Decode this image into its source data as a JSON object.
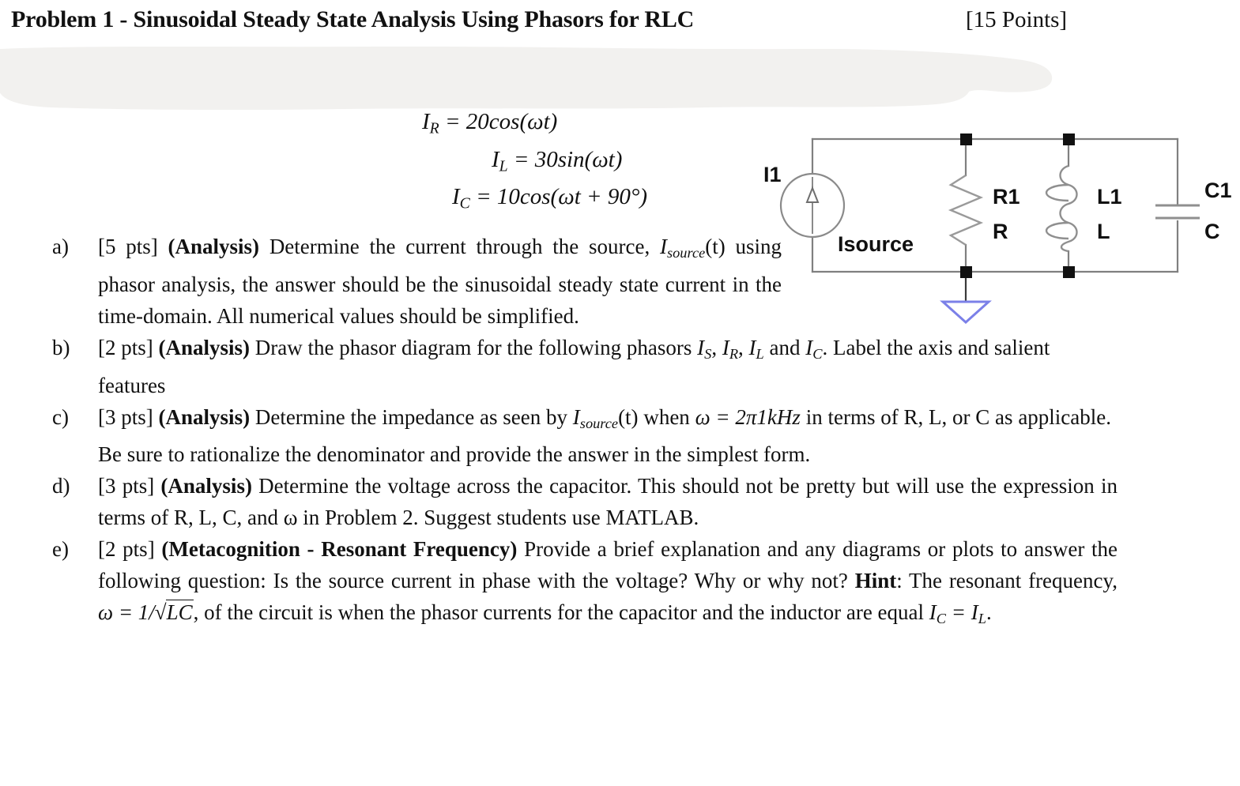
{
  "header": {
    "title": "Problem 1 - Sinusoidal Steady State Analysis Using Phasors for RLC",
    "points": "[15 Points]"
  },
  "redaction": {
    "color": "#f2f1ef",
    "note": "light gray whiteout smear covering a line of text"
  },
  "equations": {
    "line1_lhs": "I",
    "line1_sub": "R",
    "line1_rhs": "= 20cos(ωt)",
    "line2_lhs": "I",
    "line2_sub": "L",
    "line2_rhs": "= 30sin(ωt)",
    "line3_lhs": "I",
    "line3_sub": "C",
    "line3_rhs": "= 10cos(ωt + 90°)"
  },
  "circuit": {
    "source_designator": "I1",
    "source_name": "Isource",
    "resistor_designator": "R1",
    "resistor_value": "R",
    "inductor_designator": "L1",
    "inductor_value": "L",
    "capacitor_designator": "C1",
    "capacitor_value": "C",
    "ground_color": "#7b80e8",
    "wire_color": "#808080",
    "node_color": "#111111"
  },
  "items": [
    {
      "marker": "a)",
      "pts": "[5 pts]",
      "tag": "(Analysis)",
      "text_1": "Determine the current through the source, ",
      "sym": "I",
      "sym_sub": "source",
      "text_2": "(t) using phasor analysis, the answer should be the sinusoidal steady state current in the time-domain. All numerical values should be simplified."
    },
    {
      "marker": "b)",
      "pts": "[2 pts]",
      "tag": "(Analysis)",
      "text_1": "Draw the phasor diagram for the following phasors ",
      "sym_s": "I",
      "sym_s_sub": "S",
      "sep_1": ", ",
      "sym_r": "I",
      "sym_r_sub": "R",
      "sep_2": ", ",
      "sym_l": "I",
      "sym_l_sub": "L",
      "sep_3": " and ",
      "sym_c": "I",
      "sym_c_sub": "C",
      "text_2": ". Label the axis and salient features"
    },
    {
      "marker": "c)",
      "pts": "[3 pts]",
      "tag": "(Analysis)",
      "text_1": "Determine the impedance as seen by ",
      "sym": "I",
      "sym_sub": "source",
      "text_2": "(t) when ",
      "formula": "ω = 2π1kHz",
      "text_3": " in terms of R, L, or C as applicable. Be sure to rationalize the denominator and provide the answer in the simplest form."
    },
    {
      "marker": "d)",
      "pts": "[3 pts]",
      "tag": "(Analysis)",
      "text_1": "Determine the voltage across the capacitor. This should not be pretty but will use the expression in terms of R, L, C, and ω in Problem 2. Suggest students use MATLAB."
    },
    {
      "marker": "e)",
      "pts": "[2 pts]",
      "tag": "(Metacognition - Resonant Frequency)",
      "text_1": "Provide a brief explanation and any diagrams or plots to answer the following question: Is the source current in phase with the voltage? Why or why not? ",
      "hint_label": "Hint",
      "text_2": ": The resonant frequency, ",
      "formula_pre": "ω = 1/√",
      "formula_bar": "LC",
      "text_3": ", of the circuit is when the phasor currents for the capacitor and the inductor are equal ",
      "sym_c": "I",
      "sym_c_sub": "C",
      "eq_sign": " = ",
      "sym_l": "I",
      "sym_l_sub": "L",
      "text_4": "."
    }
  ]
}
